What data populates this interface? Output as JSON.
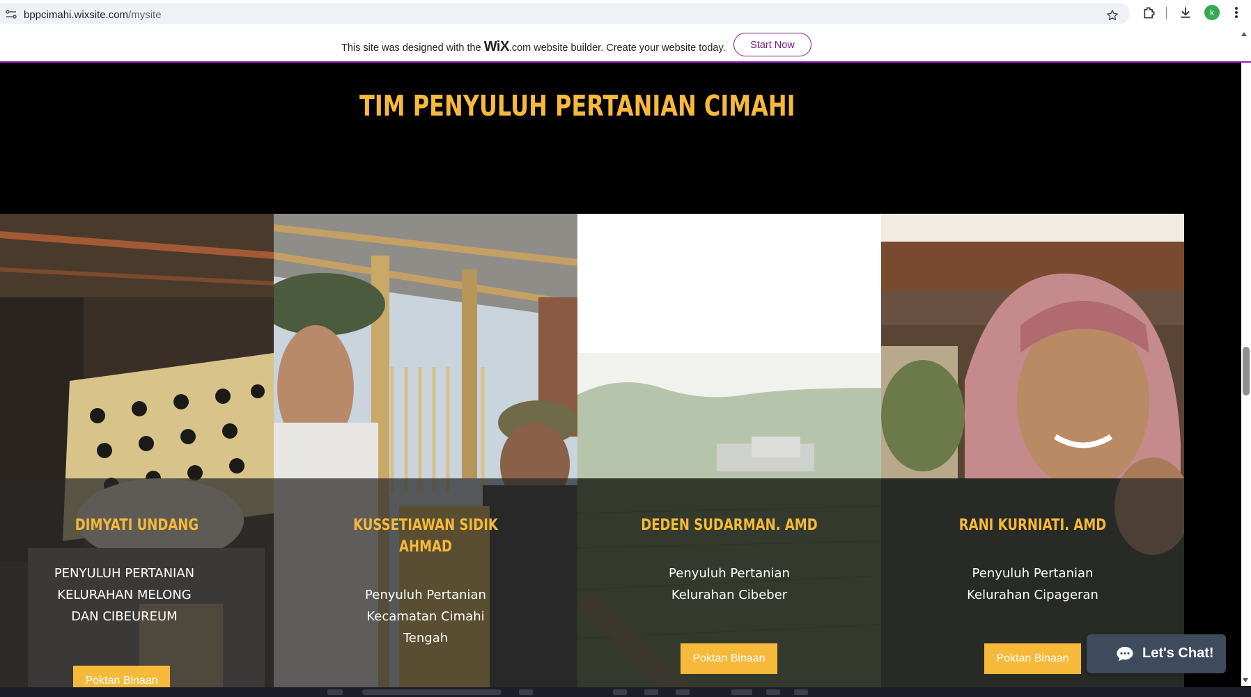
{
  "browser": {
    "url_host": "bppcimahi.wixsite.com",
    "url_path": "/mysite",
    "avatar_letter": "k"
  },
  "wix_banner": {
    "text_before": "This site was designed with the",
    "logo": "WiX",
    "logo_suffix": ".com",
    "text_after": "website builder. Create your website today.",
    "button_label": "Start Now"
  },
  "page": {
    "title": "TIM PENYULUH PERTANIAN CIMAHI"
  },
  "team": [
    {
      "name_lines": [
        "DIMYATI UNDANG"
      ],
      "role_lines": [
        "PENYULUH PERTANIAN",
        "KELURAHAN MELONG",
        "DAN CIBEUREUM"
      ],
      "button_label": "Poktan Binaan"
    },
    {
      "name_lines": [
        "KUSSETIAWAN SIDIK",
        "AHMAD"
      ],
      "role_lines": [
        "Penyuluh Pertanian",
        "Kecamatan Cimahi",
        "Tengah"
      ],
      "button_label": ""
    },
    {
      "name_lines": [
        "DEDEN SUDARMAN. AMD"
      ],
      "role_lines": [
        "Penyuluh Pertanian",
        "Kelurahan Cibeber"
      ],
      "button_label": "Poktan Binaan"
    },
    {
      "name_lines": [
        "RANI KURNIATI. AMD"
      ],
      "role_lines": [
        "Penyuluh Pertanian",
        "Kelurahan Cipageran"
      ],
      "button_label": "Poktan Binaan"
    }
  ],
  "chat": {
    "label": "Let's Chat!"
  },
  "colors": {
    "accent": "#f6b93a",
    "wix_purple": "#7a1d8c",
    "chat_bg": "#3d4b5c"
  }
}
